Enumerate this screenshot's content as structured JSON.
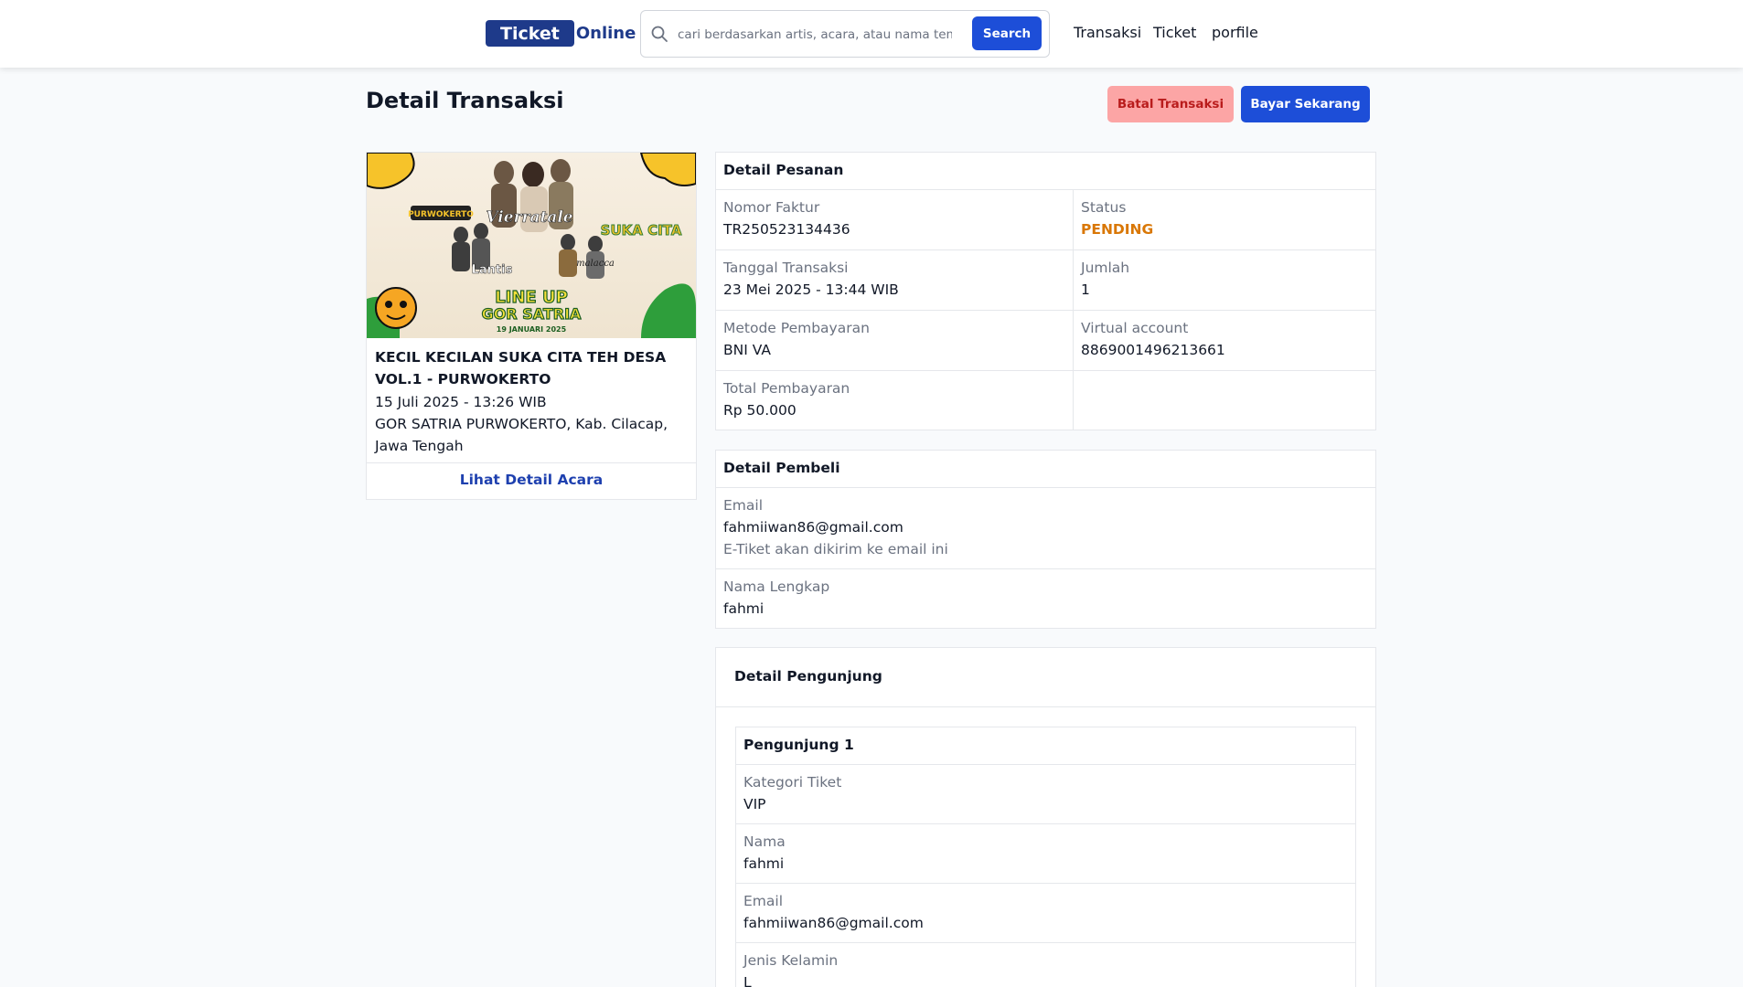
{
  "header": {
    "logo_box": "Ticket",
    "logo_text": "Online",
    "search_placeholder": "cari berdasarkan artis, acara, atau nama tempat",
    "search_button": "Search",
    "nav": [
      "Transaksi",
      "Ticket",
      "porfile"
    ]
  },
  "page": {
    "title": "Detail Transaksi",
    "cancel_button": "Batal Transaksi",
    "pay_button": "Bayar Sekarang"
  },
  "event": {
    "banner_texts": [
      "PURWOKERTO",
      "Vierratale",
      "SUKA CITA",
      "Lantis",
      "malacca",
      "LINE UP",
      "GOR SATRIA",
      "19 JANUARI 2025"
    ],
    "name": "KECIL KECILAN SUKA CITA TEH DESA VOL.1 - PURWOKERTO",
    "date": "15 Juli 2025 - 13:26 WIB",
    "venue": "GOR SATRIA PURWOKERTO, Kab. Cilacap, Jawa Tengah",
    "link": "Lihat Detail Acara"
  },
  "order": {
    "title": "Detail Pesanan",
    "invoice_label": "Nomor Faktur",
    "invoice_value": "TR250523134436",
    "status_label": "Status",
    "status_value": "PENDING",
    "date_label": "Tanggal Transaksi",
    "date_value": "23 Mei 2025 - 13:44 WIB",
    "qty_label": "Jumlah",
    "qty_value": "1",
    "method_label": "Metode Pembayaran",
    "method_value": "BNI VA",
    "va_label": "Virtual account",
    "va_value": "8869001496213661",
    "total_label": "Total Pembayaran",
    "total_value": "Rp 50.000"
  },
  "buyer": {
    "title": "Detail Pembeli",
    "email_label": "Email",
    "email_value": "fahmiiwan86@gmail.com",
    "email_note": "E-Tiket akan dikirim ke email ini",
    "name_label": "Nama Lengkap",
    "name_value": "fahmi"
  },
  "visitors": {
    "title": "Detail Pengunjung",
    "visitor_title": "Pengunjung 1",
    "category_label": "Kategori Tiket",
    "category_value": "VIP",
    "name_label": "Nama",
    "name_value": "fahmi",
    "email_label": "Email",
    "email_value": "fahmiiwan86@gmail.com",
    "gender_label": "Jenis Kelamin",
    "gender_value": "L"
  },
  "colors": {
    "brand": "#1e3a8a",
    "primary_button": "#1d4ed8",
    "cancel_button": "#fca5a5",
    "status_pending": "#d97706"
  }
}
